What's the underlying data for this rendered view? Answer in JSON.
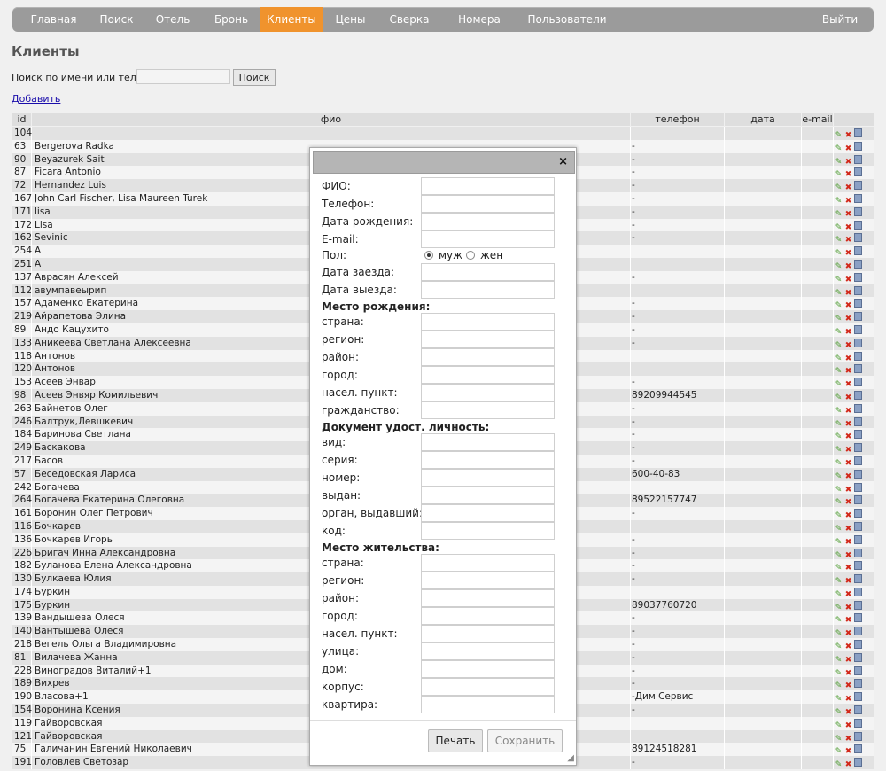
{
  "nav": {
    "items": [
      "Главная",
      "Поиск",
      "Отель",
      "Бронь",
      "Клиенты",
      "Цены",
      "Сверка",
      "Номера",
      "Пользователи"
    ],
    "active": "Клиенты",
    "logout": "Выйти"
  },
  "page": {
    "title": "Клиенты",
    "add_link": "Добавить"
  },
  "search": {
    "label": "Поиск по имени или телефону:",
    "value": "",
    "button": "Поиск"
  },
  "table": {
    "headers": {
      "id": "id",
      "name": "фио",
      "tel": "телефон",
      "dob": "дата рождения",
      "email": "e-mail"
    },
    "rows": [
      {
        "id": "104",
        "name": "",
        "tel": ""
      },
      {
        "id": "63",
        "name": "Bergerova Radka",
        "tel": "-"
      },
      {
        "id": "90",
        "name": "Beyazurek Sait",
        "tel": "-"
      },
      {
        "id": "87",
        "name": "Ficara Antonio",
        "tel": "-"
      },
      {
        "id": "72",
        "name": "Hernandez Luis",
        "tel": "-"
      },
      {
        "id": "167",
        "name": "John Carl Fischer, Lisa Maureen Turek",
        "tel": "-"
      },
      {
        "id": "171",
        "name": "lisa",
        "tel": "-"
      },
      {
        "id": "172",
        "name": "Lisa",
        "tel": "-"
      },
      {
        "id": "162",
        "name": "Sevinic",
        "tel": "-"
      },
      {
        "id": "254",
        "name": "А",
        "tel": ""
      },
      {
        "id": "251",
        "name": "А",
        "tel": ""
      },
      {
        "id": "137",
        "name": "Авраcян Алексей",
        "tel": "-"
      },
      {
        "id": "112",
        "name": "авумпавеырип",
        "tel": ""
      },
      {
        "id": "157",
        "name": "Адаменко Екатерина",
        "tel": "-"
      },
      {
        "id": "219",
        "name": "Айрапетова Элина",
        "tel": "-"
      },
      {
        "id": "89",
        "name": "Андо Кацухито",
        "tel": "-"
      },
      {
        "id": "133",
        "name": "Аникеева Светлана Алексеевна",
        "tel": "-"
      },
      {
        "id": "118",
        "name": "Антонов",
        "tel": ""
      },
      {
        "id": "120",
        "name": "Антонов",
        "tel": ""
      },
      {
        "id": "153",
        "name": "Асеев Энвар",
        "tel": "-"
      },
      {
        "id": "98",
        "name": "Асеев Энвяр Комильевич",
        "tel": "89209944545"
      },
      {
        "id": "263",
        "name": "Байнетов Олег",
        "tel": "-"
      },
      {
        "id": "246",
        "name": "Балтрук,Левшкевич",
        "tel": "-"
      },
      {
        "id": "184",
        "name": "Баринова Светлана",
        "tel": "-"
      },
      {
        "id": "249",
        "name": "Баскакова",
        "tel": "-"
      },
      {
        "id": "217",
        "name": "Басов",
        "tel": "-"
      },
      {
        "id": "57",
        "name": "Беседовская Лариса",
        "tel": "600-40-83"
      },
      {
        "id": "242",
        "name": "Богачева",
        "tel": ""
      },
      {
        "id": "264",
        "name": "Богачева Екатерина Олеговна",
        "tel": "89522157747"
      },
      {
        "id": "161",
        "name": "Боронин Олег Петрович",
        "tel": "-"
      },
      {
        "id": "116",
        "name": "Бочкарев",
        "tel": ""
      },
      {
        "id": "136",
        "name": "Бочкарев Игорь",
        "tel": "-"
      },
      {
        "id": "226",
        "name": "Бригач Инна Александровна",
        "tel": "-"
      },
      {
        "id": "182",
        "name": "Буланова Елена Александровна",
        "tel": "-"
      },
      {
        "id": "130",
        "name": "Булкаева Юлия",
        "tel": "-"
      },
      {
        "id": "174",
        "name": "Буркин",
        "tel": ""
      },
      {
        "id": "175",
        "name": "Буркин",
        "tel": "89037760720"
      },
      {
        "id": "139",
        "name": "Вандышева Олеся",
        "tel": "-"
      },
      {
        "id": "140",
        "name": "Вантышева Олеся",
        "tel": "-"
      },
      {
        "id": "218",
        "name": "Вегель Ольга Владимировна",
        "tel": "-"
      },
      {
        "id": "81",
        "name": "Вилачева Жанна",
        "tel": "-"
      },
      {
        "id": "228",
        "name": "Виноградов Виталий+1",
        "tel": "-"
      },
      {
        "id": "189",
        "name": "Вихрев",
        "tel": "-"
      },
      {
        "id": "190",
        "name": "Власова+1",
        "tel": "-Дим Сервис"
      },
      {
        "id": "154",
        "name": "Воронина Ксения",
        "tel": "-"
      },
      {
        "id": "119",
        "name": "Гайворовская",
        "tel": ""
      },
      {
        "id": "121",
        "name": "Гайворовская",
        "tel": ""
      },
      {
        "id": "75",
        "name": "Галичанин Евгений Николаевич",
        "tel": "89124518281"
      },
      {
        "id": "191",
        "name": "Головлев Светозар",
        "tel": "-"
      }
    ]
  },
  "dialog": {
    "close": "×",
    "fields1": [
      "ФИО:",
      "Телефон:",
      "Дата рождения:",
      "E-mail:"
    ],
    "gender_label": "Пол:",
    "gender_male": "муж",
    "gender_female": "жен",
    "fields2": [
      "Дата заезда:",
      "Дата выезда:"
    ],
    "section_birth": "Место рождения:",
    "birth_fields": [
      "страна:",
      "регион:",
      "район:",
      "город:",
      "насел. пункт:",
      "гражданство:"
    ],
    "section_doc": "Документ удост. личность:",
    "doc_fields": [
      "вид:",
      "серия:",
      "номер:",
      "выдан:",
      "орган, выдавший:",
      "код:"
    ],
    "section_living": "Место жительства:",
    "living_fields": [
      "страна:",
      "регион:",
      "район:",
      "город:",
      "насел. пункт:",
      "улица:",
      "дом:",
      "корпус:",
      "квартира:"
    ],
    "print_btn": "Печать",
    "save_btn": "Сохранить"
  }
}
